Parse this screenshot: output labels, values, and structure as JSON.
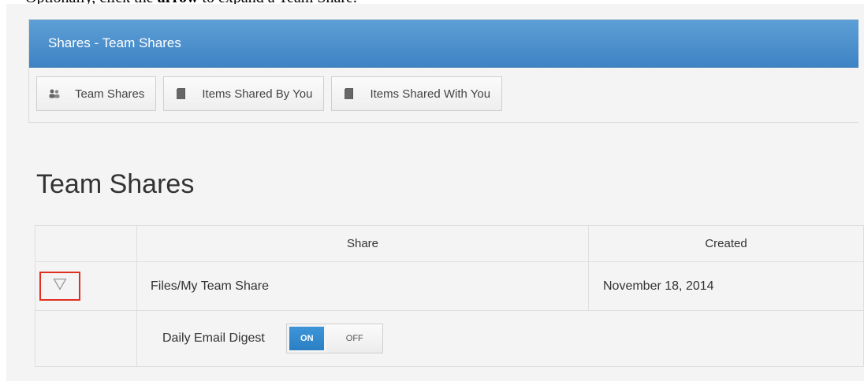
{
  "instruction": {
    "prefix": "Optionally, click the ",
    "bold": "arrow",
    "suffix": " to expand a Team Share."
  },
  "panel": {
    "title": "Shares - Team Shares",
    "tabs": [
      {
        "label": "Team Shares",
        "icon": "users-icon"
      },
      {
        "label": "Items Shared By You",
        "icon": "document-icon"
      },
      {
        "label": "Items Shared With You",
        "icon": "document-icon"
      }
    ]
  },
  "page_title": "Team Shares",
  "table": {
    "columns": [
      "",
      "Share",
      "Created"
    ],
    "rows": [
      {
        "expand_icon": "triangle-down-icon",
        "share": "Files/My Team Share",
        "created": "November 18, 2014"
      }
    ],
    "expanded": {
      "label": "Daily Email Digest",
      "toggle": {
        "on": "ON",
        "off": "OFF",
        "selected": "ON"
      }
    }
  },
  "colors": {
    "header_blue": "#4a8fcd",
    "toggle_on": "#2f86cb",
    "highlight": "#e03020"
  }
}
